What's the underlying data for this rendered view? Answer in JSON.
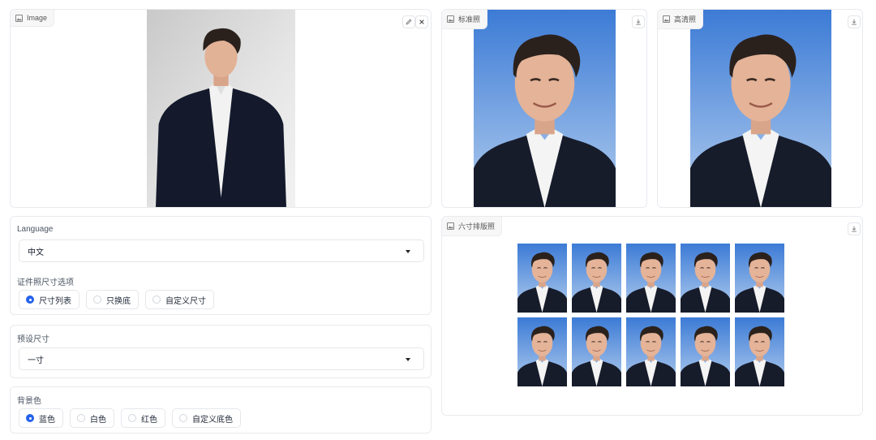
{
  "input_panel": {
    "label": "Image",
    "edit_icon": "pencil-icon",
    "close_icon": "close-icon"
  },
  "standard_panel": {
    "label": "标准照",
    "download_icon": "download-icon"
  },
  "hd_panel": {
    "label": "高清照",
    "download_icon": "download-icon"
  },
  "sheet_panel": {
    "label": "六寸排版照",
    "download_icon": "download-icon",
    "rows": 2,
    "columns": 5
  },
  "language": {
    "label": "Language",
    "value": "中文"
  },
  "size_option": {
    "label": "证件照尺寸选项",
    "options": [
      "尺寸列表",
      "只换底",
      "自定义尺寸"
    ],
    "selected": "尺寸列表"
  },
  "preset_size": {
    "label": "预设尺寸",
    "value": "一寸"
  },
  "background": {
    "label": "背景色",
    "options": [
      "蓝色",
      "白色",
      "红色",
      "自定义底色"
    ],
    "selected": "蓝色"
  },
  "colors": {
    "id_blue_top": "#3f7fd9",
    "id_blue_bottom": "#a9c6ea",
    "input_bg": "#d6d6d6",
    "suit": "#151b2d",
    "accent": "#2563eb"
  }
}
